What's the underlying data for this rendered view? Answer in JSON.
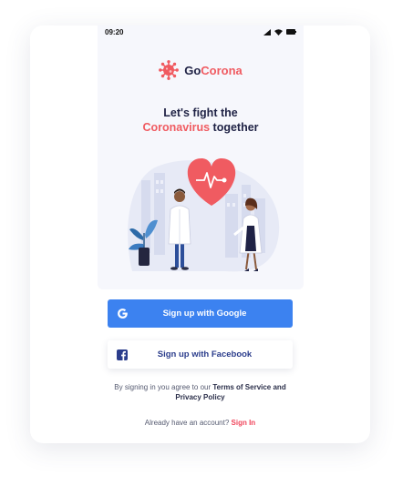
{
  "status": {
    "time": "09:20"
  },
  "brand": {
    "go": "Go",
    "corona": "Corona"
  },
  "headline": {
    "line1": "Let's fight the",
    "highlight": "Coronavirus",
    "rest": " together"
  },
  "buttons": {
    "google": "Sign up with Google",
    "facebook": "Sign up with Facebook"
  },
  "terms": {
    "prefix": "By signing in you agree to our ",
    "link": "Terms of Service and Privacy Policy"
  },
  "account": {
    "prompt": "Already have an account? ",
    "signin": "Sign In"
  },
  "icons": {
    "virus": "virus-icon",
    "google": "google-icon",
    "facebook": "facebook-icon",
    "heart": "heart-pulse-icon",
    "signal": "signal-icon",
    "wifi": "wifi-icon",
    "battery": "battery-icon"
  },
  "colors": {
    "accent_red": "#f05b61",
    "google_blue": "#3c82f0",
    "facebook_blue": "#2b3d8c",
    "dark": "#1f2245"
  }
}
